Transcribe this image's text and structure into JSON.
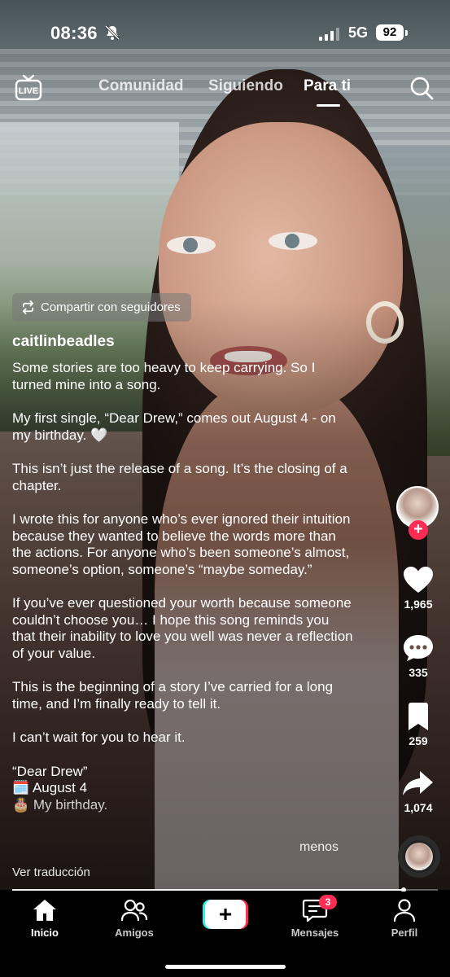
{
  "status_bar": {
    "time": "08:36",
    "network": "5G",
    "battery": "92"
  },
  "top_nav": {
    "live_label": "LIVE",
    "tabs": [
      {
        "label": "Comunidad",
        "active": false
      },
      {
        "label": "Siguiendo",
        "active": false
      },
      {
        "label": "Para ti",
        "active": true
      }
    ]
  },
  "share_chip": {
    "label": "Compartir con seguidores"
  },
  "post": {
    "username": "caitlinbeadles",
    "caption": [
      "Some stories are too heavy to keep carrying. So I turned mine into a song.",
      "My first single, “Dear Drew,” comes out August 4 - on my birthday. 🤍",
      "This isn’t just the release of a song. It’s the closing of a chapter.",
      "I wrote this for anyone who’s ever ignored their intuition because they wanted to believe the words more than the actions. For anyone who’s been someone’s almost, someone’s option, someone’s “maybe someday.”",
      "If you’ve ever questioned your worth because someone couldn’t choose you… I hope this song reminds you that their inability to love you well was never a reflection of your value.",
      "This is the beginning of a story I’ve carried for a long time, and I’m finally ready to tell it.",
      "I can’t wait for you to hear it."
    ],
    "caption_tail": [
      "“Dear Drew”",
      "🗓️ August 4",
      "🎂 My birthday."
    ],
    "less_label": "menos",
    "translate_label": "Ver traducción"
  },
  "actions": {
    "likes": "1,965",
    "comments": "335",
    "saves": "259",
    "shares": "1,074"
  },
  "playback": {
    "progress": 0.92
  },
  "bottom_nav": {
    "home": "Inicio",
    "friends": "Amigos",
    "inbox": "Mensajes",
    "inbox_badge": "3",
    "profile": "Perfil",
    "create_symbol": "+"
  },
  "colors": {
    "accent": "#fe2c55",
    "create_cyan": "#25f4ee"
  }
}
